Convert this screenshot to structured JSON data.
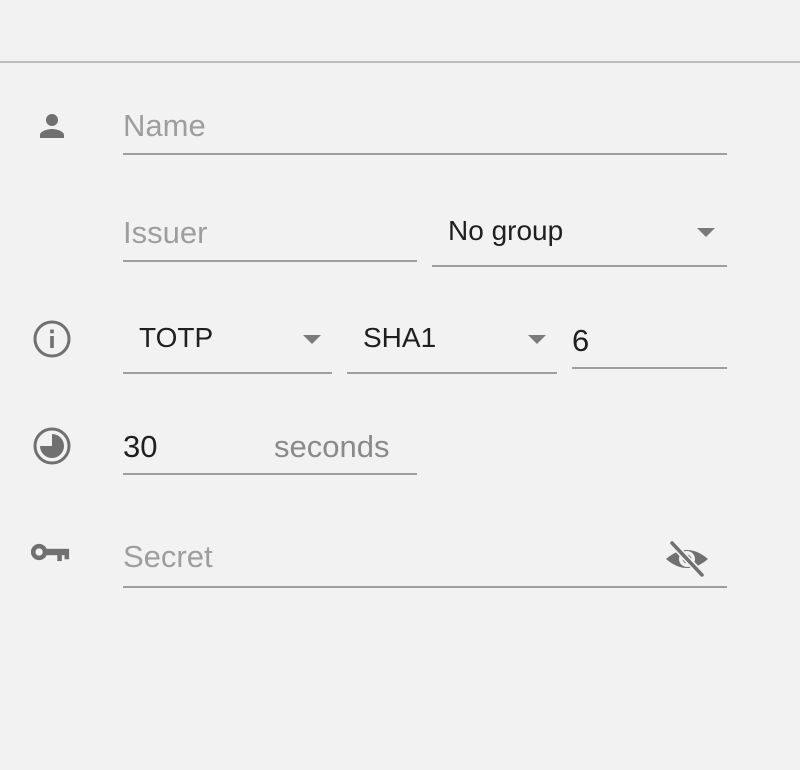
{
  "form": {
    "name": {
      "placeholder": "Name",
      "icon": "person-icon"
    },
    "issuer": {
      "placeholder": "Issuer"
    },
    "group": {
      "selected": "No group"
    },
    "type": {
      "selected": "TOTP",
      "icon": "info-icon"
    },
    "algorithm": {
      "selected": "SHA1"
    },
    "digits": {
      "value": "6"
    },
    "period": {
      "value": "30",
      "suffix": "seconds",
      "icon": "timer-icon"
    },
    "secret": {
      "placeholder": "Secret",
      "icon": "key-icon",
      "toggle_icon": "visibility-off-icon"
    }
  },
  "colors": {
    "background": "#f2f2f2",
    "icon": "#707070",
    "underline": "#9e9e9e",
    "placeholder": "#9e9e9e",
    "text": "#1f1f1f"
  }
}
